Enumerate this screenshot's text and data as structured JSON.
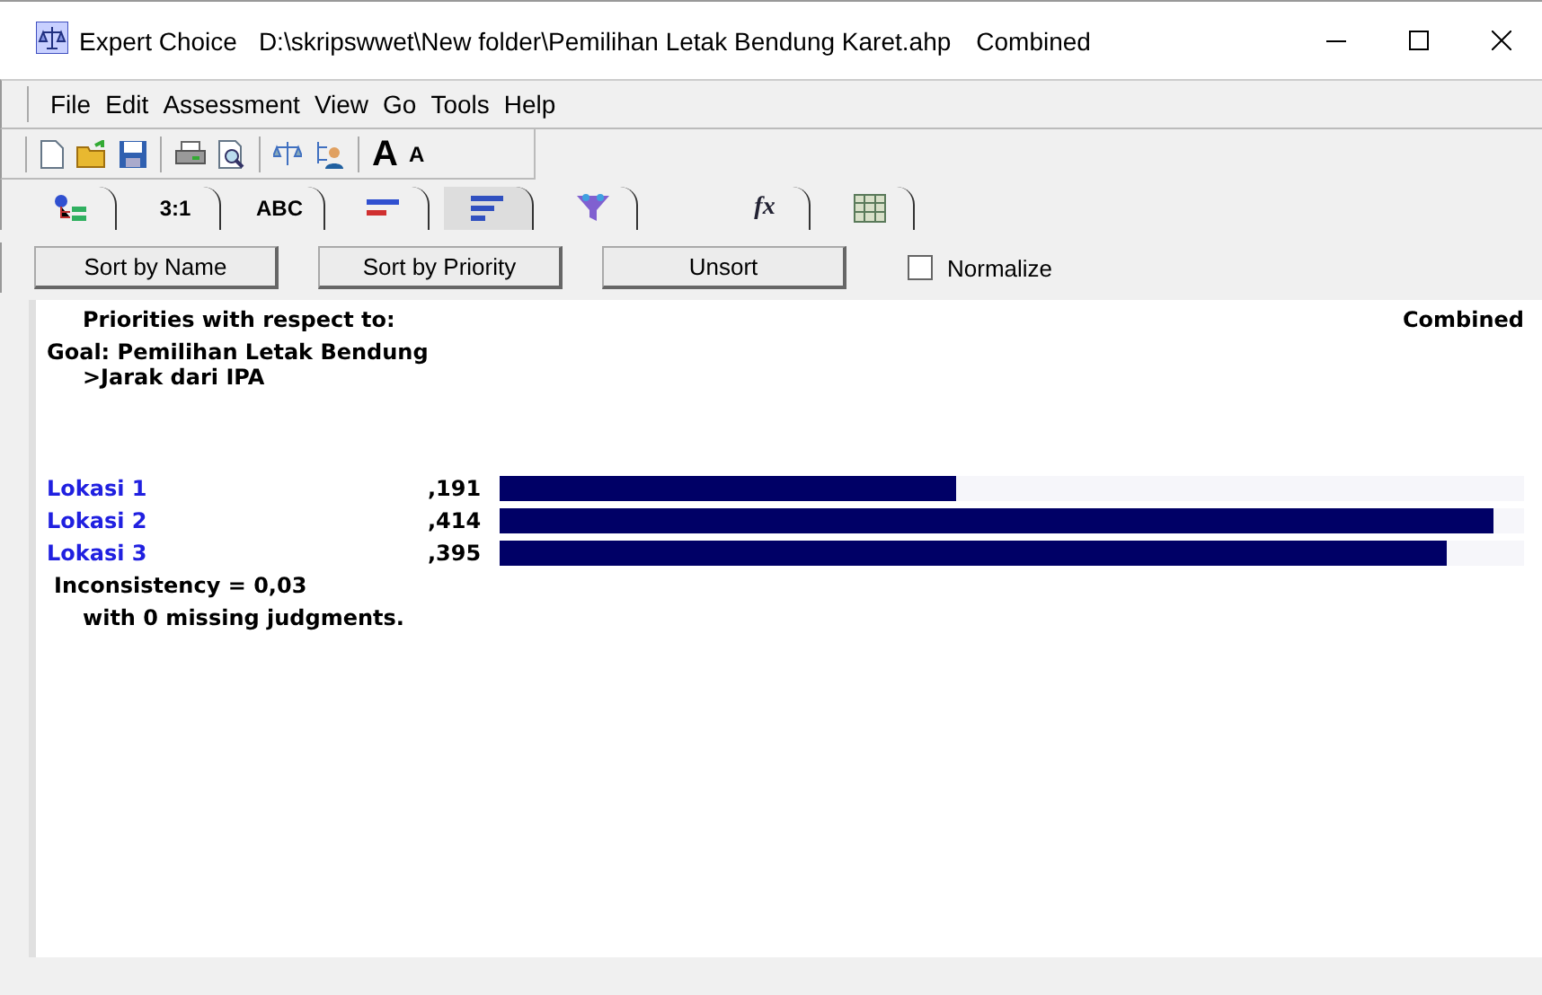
{
  "window": {
    "app_name": "Expert Choice",
    "title": "D:\\skripswwet\\New folder\\Pemilihan Letak Bendung Karet.ahp",
    "mode": "Combined"
  },
  "menu": [
    "File",
    "Edit",
    "Assessment",
    "View",
    "Go",
    "Tools",
    "Help"
  ],
  "toolbar": [
    {
      "kind": "new"
    },
    {
      "kind": "open"
    },
    {
      "kind": "save"
    },
    {
      "kind": "sep"
    },
    {
      "kind": "print"
    },
    {
      "kind": "preview"
    },
    {
      "kind": "sep"
    },
    {
      "kind": "scale"
    },
    {
      "kind": "person"
    },
    {
      "kind": "sep"
    },
    {
      "kind": "fontup",
      "label": "A"
    },
    {
      "kind": "fontdown",
      "label": "A"
    }
  ],
  "tabs": [
    {
      "kind": "tree",
      "selected": false
    },
    {
      "kind": "text",
      "label": "3:1",
      "selected": false
    },
    {
      "kind": "text",
      "label": "ABC",
      "selected": false
    },
    {
      "kind": "bars",
      "selected": false
    },
    {
      "kind": "sorted",
      "selected": true
    },
    {
      "kind": "funnel",
      "selected": false
    },
    {
      "kind": "formula",
      "label": "fx",
      "selected": false
    },
    {
      "kind": "grid",
      "selected": false
    }
  ],
  "buttons": [
    "Sort by Name",
    "Sort by Priority",
    "Unsort"
  ],
  "normalize": {
    "label": "Normalize",
    "checked": false
  },
  "results": {
    "heading": "Priorities with respect to:",
    "mode": "Combined",
    "goal": "Goal: Pemilihan Letak Bendung",
    "node": ">Jarak dari IPA",
    "items": [
      {
        "name": "Lokasi 1",
        "value": ",191",
        "level": 0.446
      },
      {
        "name": "Lokasi 2",
        "value": ",414",
        "level": 0.97
      },
      {
        "name": "Lokasi 3",
        "value": ",395",
        "level": 0.924
      }
    ],
    "inconsistency": "Inconsistency = 0,03",
    "missing": "with 0  missing judgments."
  }
}
